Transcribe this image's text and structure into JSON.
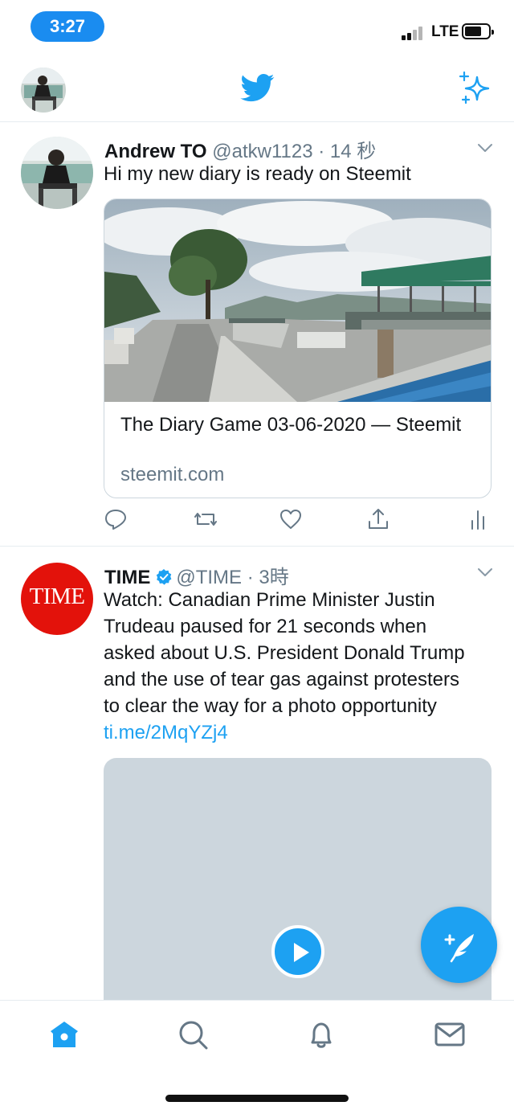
{
  "status_bar": {
    "time": "3:27",
    "network": "LTE"
  },
  "header": {
    "logo": "twitter-bird-icon",
    "compose_tweet_icon": "sparkle-icon",
    "accent_color": "#1da1f2"
  },
  "tweets": [
    {
      "author_name": "Andrew TO",
      "handle": "@atkw1123",
      "separator": "·",
      "age": "14 秒",
      "text": "Hi my new diary is ready on Steemit",
      "card": {
        "title": "The Diary Game 03-06-2020 — Steemit",
        "domain": "steemit.com"
      },
      "actions": [
        "reply-icon",
        "retweet-icon",
        "like-icon",
        "share-icon",
        "analytics-icon"
      ]
    },
    {
      "author_name": "TIME",
      "avatar_text": "TIME",
      "handle": "@TIME",
      "separator": "·",
      "age": "3時",
      "text": "Watch: Canadian Prime Minister Justin Trudeau paused for 21 seconds when asked about U.S. President Donald Trump and the use of tear gas against protesters to clear the way for a photo opportunity ",
      "link": "ti.me/2MqYZj4"
    }
  ],
  "tabs": [
    "home-icon",
    "search-icon",
    "notifications-icon",
    "messages-icon"
  ]
}
